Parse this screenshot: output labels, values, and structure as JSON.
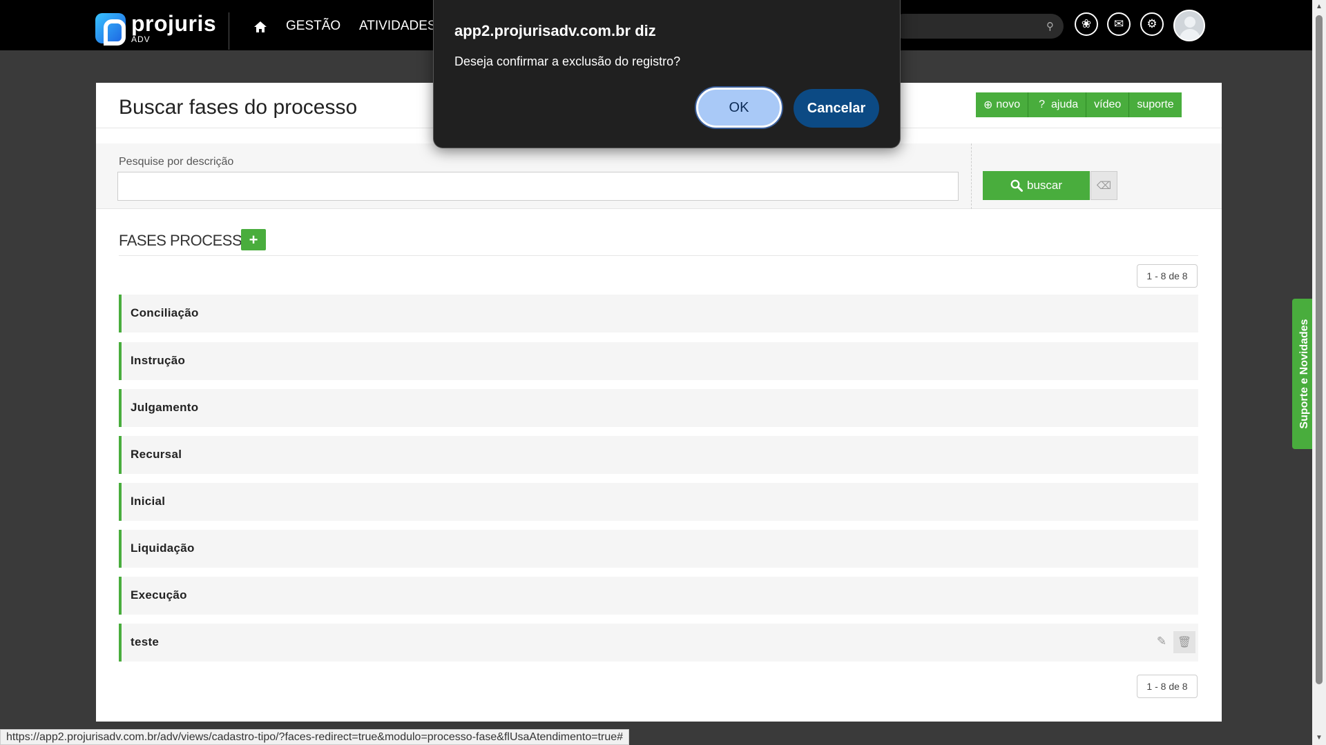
{
  "nav": {
    "logo_name": "projuris",
    "logo_sub": "ADV",
    "items": [
      "GESTÃO",
      "ATIVIDADES"
    ],
    "icons": [
      "home-icon",
      "search-icon",
      "openai-icon",
      "mail-icon",
      "gear-icon",
      "avatar"
    ]
  },
  "page": {
    "title": "Buscar fases do processo",
    "actions": [
      "novo",
      "ajuda",
      "vídeo",
      "suporte"
    ]
  },
  "search": {
    "label": "Pesquise por descrição",
    "value": "",
    "button": "buscar"
  },
  "section": {
    "title": "FASES PROCESSO",
    "pager": "1 - 8 de 8"
  },
  "items": [
    "Conciliação",
    "Instrução",
    "Julgamento",
    "Recursal",
    "Inicial",
    "Liquidação",
    "Execução",
    "teste"
  ],
  "side_tab": "Suporte e Novidades",
  "status_url": "https://app2.projurisadv.com.br/adv/views/cadastro-tipo/?faces-redirect=true&modulo=processo-fase&flUsaAtendimento=true#",
  "dialog": {
    "title": "app2.projurisadv.com.br diz",
    "message": "Deseja confirmar a exclusão do registro?",
    "ok": "OK",
    "cancel": "Cancelar"
  },
  "colors": {
    "accent_green": "#49ad3d",
    "nav_bg": "#000000",
    "dialog_bg": "#202020",
    "ok_bg": "#a9c9f7",
    "cancel_bg": "#0c4a84"
  }
}
